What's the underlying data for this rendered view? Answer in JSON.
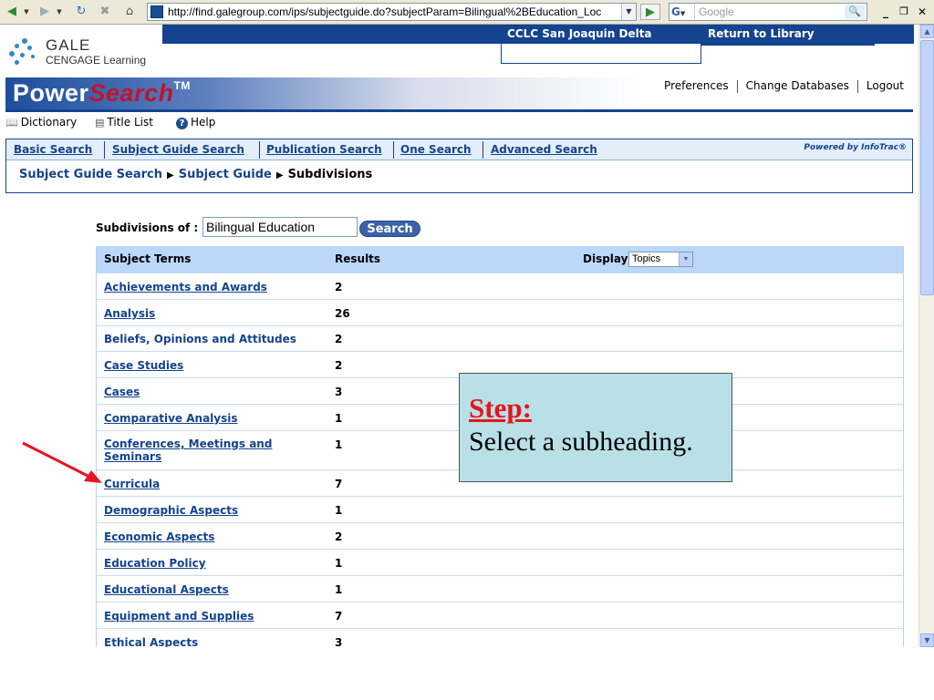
{
  "browser": {
    "url": "http://find.galegroup.com/ips/subjectguide.do?subjectParam=Bilingual%2BEducation_Loc",
    "google_placeholder": "Google",
    "google_label": "G"
  },
  "header": {
    "gale_name": "GALE",
    "gale_sub": "CENGAGE Learning",
    "library_name": "CCLC San Joaquin Delta",
    "return_link": "Return to Library",
    "product_power": "Power",
    "product_search": "Search",
    "product_tm": "TM",
    "links": [
      "Preferences",
      "Change Databases",
      "Logout"
    ]
  },
  "tools": [
    "Dictionary",
    "Title List",
    "Help"
  ],
  "tabs": [
    "Basic Search",
    "Subject Guide Search",
    "Publication Search",
    "One Search",
    "Advanced Search"
  ],
  "powered_by": "Powered by InfoTrac®",
  "breadcrumb": [
    "Subject Guide Search",
    "Subject Guide",
    "Subdivisions"
  ],
  "search": {
    "label": "Subdivisions of :",
    "value": "Bilingual Education",
    "button": "Search"
  },
  "table": {
    "col_term": "Subject Terms",
    "col_results": "Results",
    "display_label": "Display",
    "display_value": "Topics",
    "rows": [
      {
        "term": "Achievements and Awards",
        "results": "2"
      },
      {
        "term": "Analysis",
        "results": "26"
      },
      {
        "term": "Beliefs, Opinions and Attitudes",
        "results": "2"
      },
      {
        "term": "Case Studies",
        "results": "2"
      },
      {
        "term": "Cases",
        "results": "3"
      },
      {
        "term": "Comparative Analysis",
        "results": "1"
      },
      {
        "term": "Conferences, Meetings and Seminars",
        "results": "1"
      },
      {
        "term": "Curricula",
        "results": "7"
      },
      {
        "term": "Demographic Aspects",
        "results": "1"
      },
      {
        "term": "Economic Aspects",
        "results": "2"
      },
      {
        "term": "Education Policy",
        "results": "1"
      },
      {
        "term": "Educational Aspects",
        "results": "1"
      },
      {
        "term": "Equipment and Supplies",
        "results": "7"
      },
      {
        "term": "Ethical Aspects",
        "results": "3"
      }
    ]
  },
  "callout": {
    "title": "Step:",
    "text": "Select a subheading."
  },
  "colors": {
    "brand_blue": "#14438f",
    "header_row": "#bbd8f8",
    "callout_bg": "#b8e0e6",
    "arrow_red": "#e8141e"
  }
}
